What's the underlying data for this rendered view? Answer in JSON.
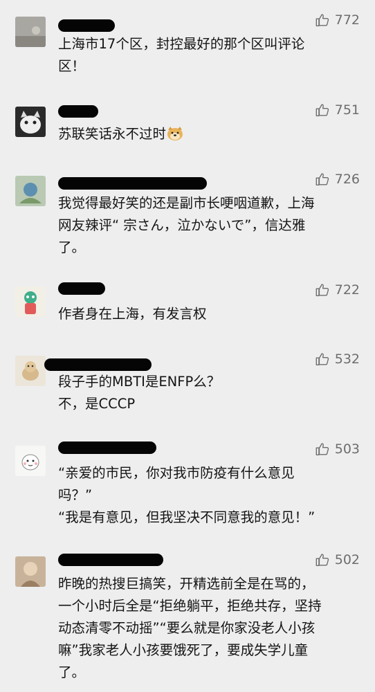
{
  "comments": [
    {
      "user": "",
      "likes": "772",
      "text": "上海市17个区，封控最好的那个区叫评论\n区！"
    },
    {
      "user": "",
      "likes": "751",
      "text": "苏联笑话永不过时",
      "emoji": "doge-emoji"
    },
    {
      "user": "",
      "likes": "726",
      "text": "我觉得最好笑的还是副市长哽咽道歉，上海\n网友辣评“ 宗さん，泣かないで”，信达雅\n了。"
    },
    {
      "user": "",
      "likes": "722",
      "text": "作者身在上海，有发言权"
    },
    {
      "user": "",
      "likes": "532",
      "text": "段子手的MBTI是ENFP么？\n不，是CCCP"
    },
    {
      "user": "",
      "likes": "503",
      "text": "“亲爱的市民，你对我市防疫有什么意见\n吗？”\n“我是有意见，但我坚决不同意我的意见！”"
    },
    {
      "user": "",
      "likes": "502",
      "text": "昨晚的热搜巨搞笑，开精选前全是在骂的，\n一个小时后全是“拒绝躺平，拒绝共存，坚持\n动态清零不动摇”“要么就是你家没老人小孩\n嘛”我家老人小孩要饿死了，要成失学儿童\n了。"
    }
  ],
  "icons": {
    "like": "thumbs-up-icon"
  },
  "colors": {
    "background": "#eeeeef",
    "text": "#141414",
    "likeCount": "#6d6d6d"
  }
}
